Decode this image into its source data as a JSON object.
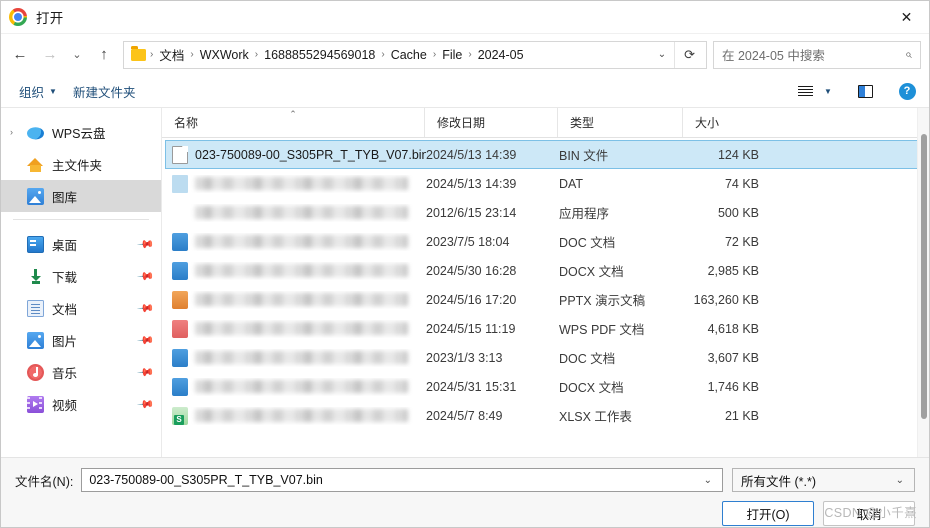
{
  "window": {
    "title": "打开",
    "app_icon": "chrome-logo-icon",
    "close_label": "✕"
  },
  "nav": {
    "back_icon": "arrow-left-icon",
    "forward_icon": "arrow-right-icon",
    "recent_icon": "chevron-down-icon",
    "up_icon": "arrow-up-icon",
    "breadcrumb": [
      "文档",
      "WXWork",
      "1688855294569018",
      "Cache",
      "File",
      "2024-05"
    ],
    "breadcrumb_chevron": "⌄",
    "refresh_icon": "⟳",
    "search_placeholder": "在 2024-05 中搜索",
    "search_icon": "⌕"
  },
  "toolbar": {
    "organize_label": "组织",
    "organize_caret": "▼",
    "new_folder_label": "新建文件夹",
    "view_icon": "list-view-icon",
    "view_caret": "▼",
    "preview_pane_icon": "preview-pane-icon",
    "help_label": "?"
  },
  "sidebar": {
    "groups": [
      {
        "items": [
          {
            "label": "WPS云盘",
            "icon": "cloud-icon",
            "expander": "›",
            "selected": false,
            "pinned": false
          },
          {
            "label": "主文件夹",
            "icon": "home-icon",
            "expander": "",
            "selected": false,
            "pinned": false
          },
          {
            "label": "图库",
            "icon": "gallery-icon",
            "expander": "",
            "selected": true,
            "pinned": false
          }
        ]
      },
      {
        "items": [
          {
            "label": "桌面",
            "icon": "desktop-icon",
            "expander": "",
            "selected": false,
            "pinned": true
          },
          {
            "label": "下载",
            "icon": "download-icon",
            "expander": "",
            "selected": false,
            "pinned": true
          },
          {
            "label": "文档",
            "icon": "documents-icon",
            "expander": "",
            "selected": false,
            "pinned": true
          },
          {
            "label": "图片",
            "icon": "pictures-icon",
            "expander": "",
            "selected": false,
            "pinned": true
          },
          {
            "label": "音乐",
            "icon": "music-icon",
            "expander": "",
            "selected": false,
            "pinned": true
          },
          {
            "label": "视频",
            "icon": "video-icon",
            "expander": "",
            "selected": false,
            "pinned": true
          }
        ]
      }
    ],
    "pin_icon": "📌"
  },
  "filelist": {
    "columns": {
      "name": "名称",
      "date": "修改日期",
      "type": "类型",
      "size": "大小",
      "sort_caret": "⌃"
    },
    "rows": [
      {
        "name": "023-750089-00_S305PR_T_TYB_V07.bin",
        "redacted": false,
        "date": "2024/5/13 14:39",
        "type": "BIN 文件",
        "size": "124 KB",
        "icon": "bin-file-icon",
        "selected": true
      },
      {
        "name": "",
        "redacted": true,
        "date": "2024/5/13 14:39",
        "type": "DAT",
        "size": "74 KB",
        "icon": "dat-file-icon",
        "selected": false
      },
      {
        "name": "",
        "redacted": true,
        "date": "2012/6/15 23:14",
        "type": "应用程序",
        "size": "500 KB",
        "icon": "exe-file-icon",
        "selected": false
      },
      {
        "name": "",
        "redacted": true,
        "date": "2023/7/5 18:04",
        "type": "DOC 文档",
        "size": "72 KB",
        "icon": "doc-file-icon",
        "selected": false
      },
      {
        "name": "",
        "redacted": true,
        "date": "2024/5/30 16:28",
        "type": "DOCX 文档",
        "size": "2,985 KB",
        "icon": "docx-file-icon",
        "selected": false
      },
      {
        "name": "",
        "redacted": true,
        "date": "2024/5/16 17:20",
        "type": "PPTX 演示文稿",
        "size": "163,260 KB",
        "icon": "ppt-file-icon",
        "selected": false
      },
      {
        "name": "",
        "redacted": true,
        "date": "2024/5/15 11:19",
        "type": "WPS PDF 文档",
        "size": "4,618 KB",
        "icon": "pdf-file-icon",
        "selected": false
      },
      {
        "name": "",
        "redacted": true,
        "date": "2023/1/3 3:13",
        "type": "DOC 文档",
        "size": "3,607 KB",
        "icon": "doc-file-icon",
        "selected": false
      },
      {
        "name": "",
        "redacted": true,
        "date": "2024/5/31 15:31",
        "type": "DOCX 文档",
        "size": "1,746 KB",
        "icon": "docx-file-icon",
        "selected": false
      },
      {
        "name": "",
        "redacted": true,
        "date": "2024/5/7 8:49",
        "type": "XLSX 工作表",
        "size": "21 KB",
        "icon": "xls-file-icon",
        "selected": false
      }
    ]
  },
  "footer": {
    "filename_label": "文件名(N):",
    "filename_value": "023-750089-00_S305PR_T_TYB_V07.bin",
    "filename_caret": "⌄",
    "filter_value": "所有文件 (*.*)",
    "filter_caret": "⌄",
    "open_label": "打开(O)",
    "cancel_label": "取消"
  },
  "watermark": "CSDN @小千熹"
}
